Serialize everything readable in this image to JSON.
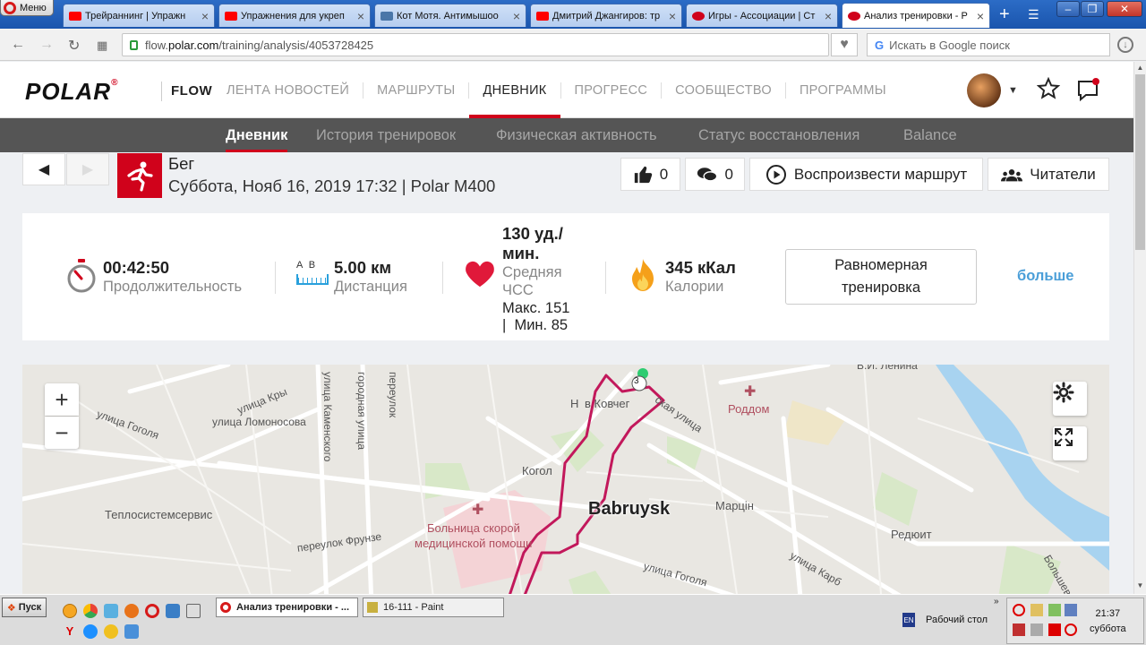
{
  "browser": {
    "menu_label": "Меню",
    "tabs": [
      {
        "title": "Трейраннинг | Упражн",
        "favicon_color": "#ff0000"
      },
      {
        "title": "Упражнения для укреп",
        "favicon_color": "#ff0000"
      },
      {
        "title": "Кот Мотя. Антимышоо",
        "favicon_color": "#4a76a8"
      },
      {
        "title": "Дмитрий Джангиров: тр",
        "favicon_color": "#ff0000"
      },
      {
        "title": "Игры - Ассоциации | Ст",
        "favicon_color": "#d0021b"
      },
      {
        "title": "Анализ тренировки - Р",
        "favicon_color": "#d0021b"
      }
    ],
    "url_prefix": "flow.",
    "url_domain": "polar.com",
    "url_path": "/training/analysis/4053728425",
    "search_placeholder": "Искать в Google поиск",
    "search_g": "G"
  },
  "site": {
    "logo_text": "POLAR",
    "product": "FLOW",
    "nav": [
      "ЛЕНТА НОВОСТЕЙ",
      "МАРШРУТЫ",
      "ДНЕВНИК",
      "ПРОГРЕСС",
      "СООБЩЕСТВО",
      "ПРОГРАММЫ"
    ],
    "nav_active_index": 2,
    "subnav": [
      "Дневник",
      "История тренировок",
      "Физическая активность",
      "Статус восстановления",
      "Balance"
    ],
    "subnav_active_index": 0
  },
  "session": {
    "sport": "Бег",
    "info": "Суббота, Нояб 16, 2019 17:32 | Polar M400",
    "likes": "0",
    "comments": "0",
    "replay_label": "Воспроизвести маршрут",
    "readers_label": "Читатели"
  },
  "summary": {
    "duration_value": "00:42:50",
    "duration_label": "Продолжительность",
    "distance_value": "5.00 км",
    "distance_label": "Дистанция",
    "distance_ab": "A  B",
    "hr_value": "130 уд./мин.",
    "hr_label": "Средняя ЧСС",
    "hr_max": "Макс. 151",
    "hr_min": "|  Мин. 85",
    "calories_value": "345 кКал",
    "calories_label": "Калории",
    "training_type": "Равномерная тренировка",
    "more_label": "больше"
  },
  "map": {
    "zoom_in": "+",
    "zoom_out": "−",
    "city": "Babruysk",
    "lap_marker": "3",
    "labels": {
      "v_i_lenina": "В.И. Ленина",
      "ulitsa_kry": "улица Кры",
      "kamenskogo": "улица Каменского",
      "gorodnaya": "городная улица",
      "pereulok": "переулок",
      "lomonosova": "улица Ломоносова",
      "gogolya1": "улица Гоголя",
      "gogolya2": "улица Гоголя",
      "kovcheg": "Н",
      "kovcheg_full": "в Ковчег",
      "skaya": "ская улица",
      "roddom": "Роддом",
      "kogo": "Когол",
      "teplo": "Теплосистемсервис",
      "bolnica1": "Больница скорой",
      "bolnica2": "медицинской помощи",
      "martsin": "Марцін",
      "reduit": "Редюит",
      "frunze": "переулок Фрунзе",
      "karb": "улица Карб",
      "bolsheti": "Большеви"
    }
  },
  "taskbar": {
    "start_label": "Пуск",
    "tasks": [
      "Анализ тренировки - ...",
      "16-111 - Paint"
    ],
    "lang": "EN",
    "desktop_label": "Рабочий стол",
    "time": "21:37",
    "day": "суббота"
  }
}
